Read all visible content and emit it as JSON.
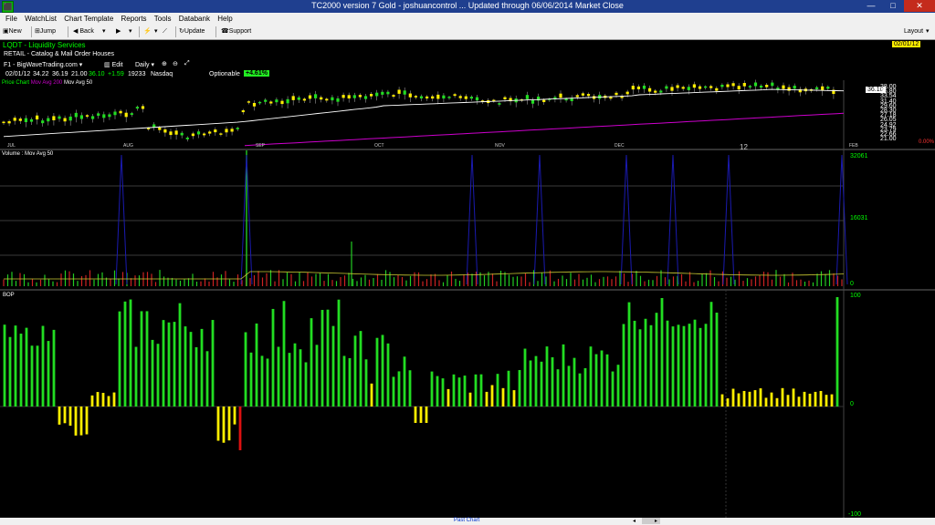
{
  "window": {
    "title": "TC2000 version 7 Gold - joshuancontrol  ... Updated through 06/06/2014  Market Close",
    "minimize": "—",
    "maximize": "□",
    "close": "✕"
  },
  "menu": [
    "File",
    "WatchList",
    "Chart Template",
    "Reports",
    "Tools",
    "Databank",
    "Help"
  ],
  "toolbar": {
    "new": "New",
    "jump": "Jump",
    "back": "Back",
    "update": "Update",
    "support": "Support",
    "layout": "Layout"
  },
  "header": {
    "symbol": "LQDT - Liquidity Services",
    "industry": "RETAIL - Catalog & Mail Order Houses",
    "date_badge": "02/01/12",
    "template": "F1 - BigWaveTrading.com",
    "edit": "Edit",
    "period": "Daily",
    "quote_date": "02/01/12",
    "open": "34.22",
    "high": "36.19",
    "low": "21.00",
    "close": "36.10",
    "change": "+1.59",
    "volume": "19233",
    "exchange": "Nasdaq",
    "optionable": "Optionable",
    "pct_change": "+4.61%"
  },
  "legend": {
    "price_chart": "Price Chart",
    "ma200": "Mov Avg 200",
    "ma50": "Mov Avg 50",
    "volume": "Volume",
    "vol_ma": "Mov Avg 50",
    "bop": "BOP"
  },
  "price_axis": {
    "last": "36.10",
    "ticks": [
      "38.00",
      "35.80",
      "33.54",
      "31.40",
      "29.60",
      "28.30",
      "27.18",
      "26.05",
      "24.92",
      "23.79",
      "22.66",
      "21.00"
    ],
    "pct": "0.00%"
  },
  "months": [
    "JUL",
    "AUG",
    "SEP",
    "OCT",
    "NOV",
    "DEC",
    "12",
    "FEB"
  ],
  "volume_axis": {
    "max": "32061",
    "mid": "16031",
    "zero": "0"
  },
  "bop_axis": {
    "top": "100",
    "zero": "0",
    "bottom": "-100"
  },
  "status": {
    "past_chart": "Past Chart"
  },
  "colors": {
    "up": "#22dd22",
    "down": "#ffee00",
    "neg": "#dd1111",
    "ma200": "#cc00cc",
    "ma50": "#ffffff",
    "spike": "#1a1ab0"
  }
}
